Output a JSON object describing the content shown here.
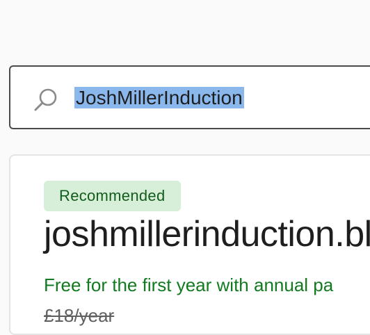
{
  "search": {
    "value": "JoshMillerInduction",
    "icon": "search-icon"
  },
  "result": {
    "badge": "Recommended",
    "domain": "joshmillerinduction.bl",
    "offer": "Free for the first year with annual pa",
    "original_price": "£18/year"
  },
  "colors": {
    "selection_highlight": "#8ab8ec",
    "badge_background": "#d7efd9",
    "badge_text": "#145c1c",
    "offer_text": "#127a1f",
    "strikethrough_price": "#5f5f5f"
  }
}
